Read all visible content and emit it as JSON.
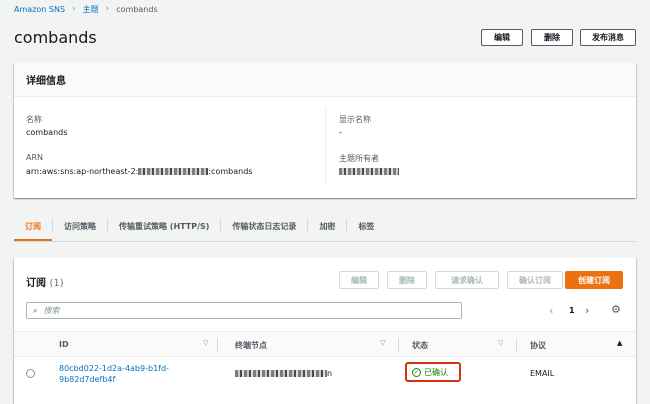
{
  "breadcrumb": {
    "items": [
      "Amazon SNS",
      "主题",
      "combands"
    ]
  },
  "page": {
    "title": "combands"
  },
  "actions": {
    "edit": "编辑",
    "delete": "删除",
    "publish": "发布消息"
  },
  "details": {
    "heading": "详细信息",
    "name_label": "名称",
    "name_value": "combands",
    "arn_label": "ARN",
    "arn_prefix": "arn:aws:sns:ap-northeast-2:",
    "arn_suffix": ":combands",
    "display_label": "显示名称",
    "display_value": "-",
    "owner_label": "主题所有者"
  },
  "tabs": [
    "订阅",
    "访问策略",
    "传输重试策略 (HTTP/S)",
    "传输状态日志记录",
    "加密",
    "标签"
  ],
  "subs": {
    "title": "订阅",
    "count": "(1)",
    "buttons": {
      "edit": "编辑",
      "delete": "删除",
      "request": "请求确认",
      "confirm": "确认订阅",
      "create": "创建订阅"
    },
    "search_placeholder": "搜索",
    "page": "1",
    "columns": [
      "ID",
      "终端节点",
      "状态",
      "协议"
    ],
    "rows": [
      {
        "id_line1": "80cbd022-1d2a-4ab9-b1fd-",
        "id_line2": "9b82d7defb4f",
        "endpoint_suffix": "n",
        "status": "已确认",
        "protocol": "EMAIL"
      }
    ]
  },
  "colors": {
    "accent": "#ec7211",
    "link": "#0073bb",
    "success": "#1d8102",
    "highlight": "#d13212"
  }
}
